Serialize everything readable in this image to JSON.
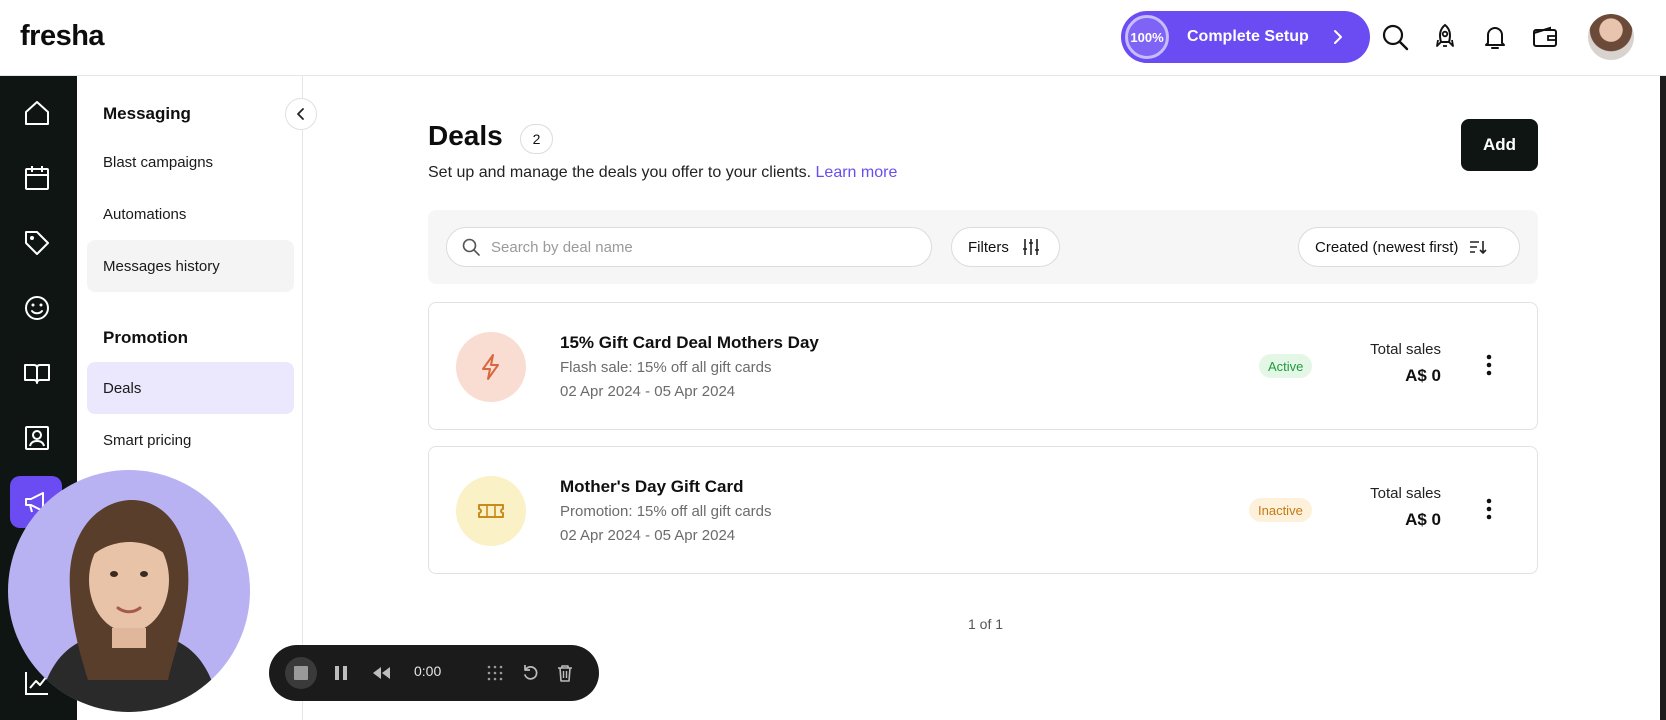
{
  "app": {
    "logo": "fresha"
  },
  "header": {
    "setup_progress": "100%",
    "setup_label": "Complete Setup"
  },
  "sidebar": {
    "sections": [
      {
        "heading": "Messaging",
        "items": [
          "Blast campaigns",
          "Automations",
          "Messages history"
        ]
      },
      {
        "heading": "Promotion",
        "items": [
          "Deals",
          "Smart pricing"
        ]
      }
    ]
  },
  "main": {
    "title": "Deals",
    "count": "2",
    "subtitle": "Set up and manage the deals you offer to your clients.",
    "learn_more": "Learn more",
    "add_label": "Add",
    "search_placeholder": "Search by deal name",
    "filters_label": "Filters",
    "sort_label": "Created (newest first)",
    "pagination": "1 of 1"
  },
  "deals": [
    {
      "name": "15% Gift Card Deal Mothers Day",
      "description": "Flash sale: 15% off all gift cards",
      "dates": "02 Apr 2024 - 05 Apr 2024",
      "status": "Active",
      "sales_label": "Total sales",
      "sales_value": "A$ 0",
      "icon": "lightning-icon",
      "icon_bg": "#f9ddd3",
      "icon_color": "#d9683e"
    },
    {
      "name": "Mother's Day Gift Card",
      "description": "Promotion: 15% off all gift cards",
      "dates": "02 Apr 2024 - 05 Apr 2024",
      "status": "Inactive",
      "sales_label": "Total sales",
      "sales_value": "A$ 0",
      "icon": "ticket-icon",
      "icon_bg": "#fbf1c6",
      "icon_color": "#c98a1e"
    }
  ],
  "recorder": {
    "time": "0:00"
  },
  "colors": {
    "accent": "#6a4cf2",
    "dark": "#0e1512"
  }
}
